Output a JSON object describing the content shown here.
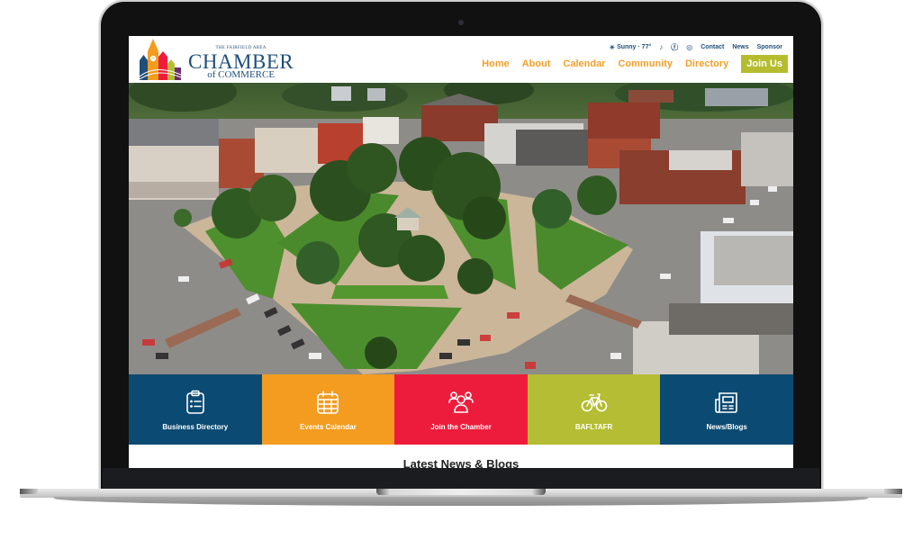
{
  "site": {
    "logo": {
      "small_text": "THE FAIRFIELD AREA",
      "big_text": "CHAMBER",
      "sub_text": "of COMMERCE"
    },
    "topbar": {
      "weather": "Sunny · 77°",
      "social_icons": [
        "tiktok-icon",
        "facebook-icon",
        "instagram-icon"
      ],
      "links": [
        "Contact",
        "News",
        "Sponsor"
      ]
    },
    "nav": {
      "items": [
        "Home",
        "About",
        "Calendar",
        "Community",
        "Directory"
      ],
      "cta": "Join Us"
    },
    "hero": {
      "description": "Aerial view of town square park with gazebo"
    },
    "tiles": [
      {
        "label": "Business Directory",
        "icon": "clipboard-list-icon",
        "color": "#0b4a72"
      },
      {
        "label": "Events Calendar",
        "icon": "calendar-icon",
        "color": "#f39c1f"
      },
      {
        "label": "Join the Chamber",
        "icon": "people-icon",
        "color": "#ee1c3c"
      },
      {
        "label": "BAFLTAFR",
        "icon": "bicycle-icon",
        "color": "#b4bd33"
      },
      {
        "label": "News/Blogs",
        "icon": "newspaper-icon",
        "color": "#0b4a72"
      }
    ],
    "section_heading": "Latest News & Blogs"
  },
  "colors": {
    "brand_blue": "#1f4e79",
    "nav_orange": "#f4a02a",
    "cta_green": "#b5bd2f"
  }
}
